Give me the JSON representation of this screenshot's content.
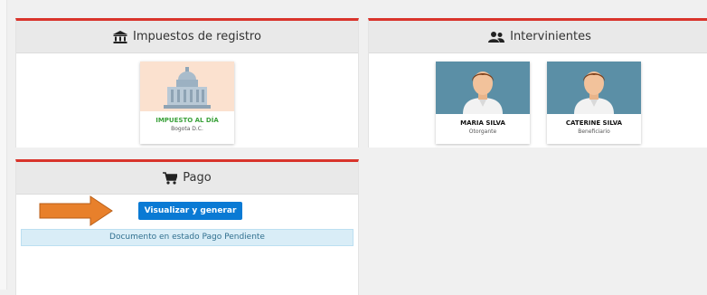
{
  "impuestos": {
    "title": "Impuestos de registro",
    "icon": "bank-icon",
    "card": {
      "title": "IMPUESTO AL DÍA",
      "subtitle": "Bogota D.C.",
      "title_color": "#3aa13a"
    }
  },
  "intervinientes": {
    "title": "Intervinientes",
    "icon": "people-icon",
    "people": [
      {
        "name": "MARIA SILVA",
        "role": "Otorgante"
      },
      {
        "name": "CATERINE SILVA",
        "role": "Beneficiario"
      }
    ]
  },
  "pago": {
    "title": "Pago",
    "icon": "cart-icon",
    "button_label": "Visualizar y generar",
    "status_text": "Documento en estado Pago Pendiente"
  },
  "colors": {
    "accent_border": "#d9342b",
    "button": "#0a7ad4",
    "arrow": "#e8802b",
    "status_bg": "#d9edf7"
  }
}
